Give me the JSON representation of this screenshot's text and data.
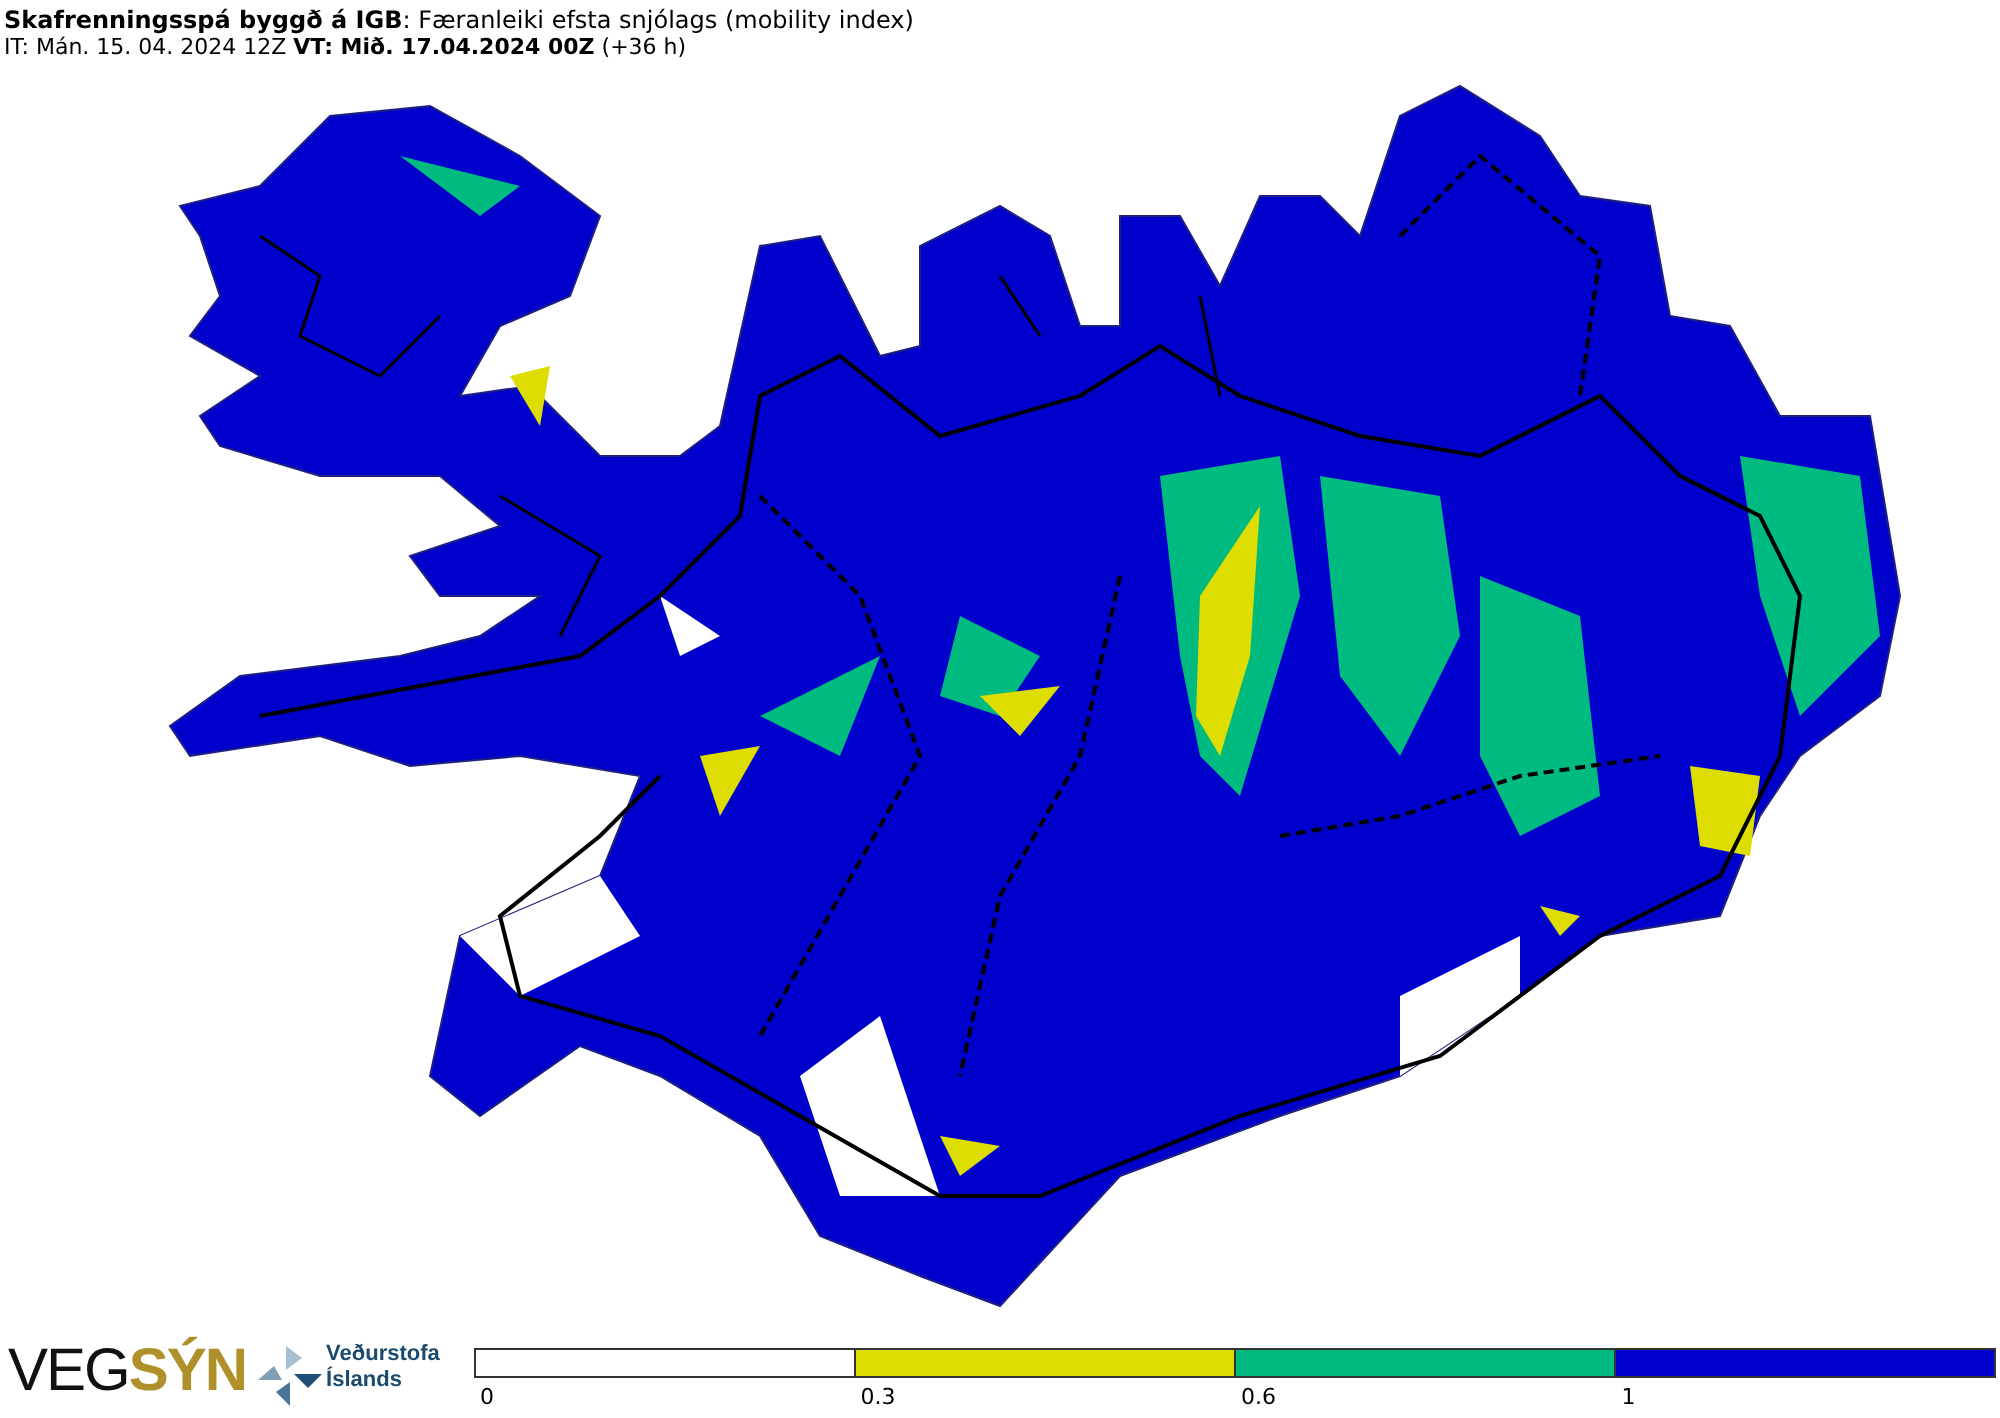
{
  "header": {
    "title": "**Skafrenningsspá byggð á IGB**: Færanleiki efsta snjólags (mobility index)",
    "time_line": "IT: Mán. 15. 04. 2024 12Z **VT: Mið. 17.04.2024 00Z** (+36 h)"
  },
  "logos": {
    "vegsyn": "VEG**SÝN**",
    "vedurstofa_line_1": "Veðurstofa",
    "vedurstofa_line_2": "Íslands"
  },
  "legend": {
    "bins": [
      {
        "color": "#ffffff"
      },
      {
        "color": "#dddd00"
      },
      {
        "color": "#00bb80"
      },
      {
        "color": "#0000cc"
      }
    ],
    "ticks": [
      "0",
      "0.3",
      "0.6",
      "1"
    ]
  }
}
